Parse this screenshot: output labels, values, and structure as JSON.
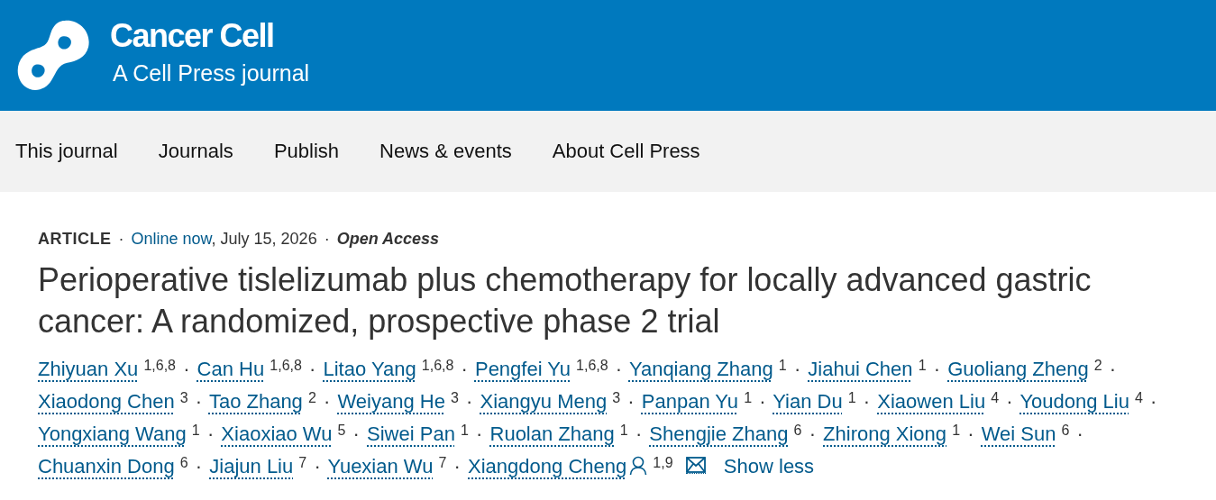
{
  "header": {
    "journal": "Cancer Cell",
    "subtitle": "A Cell Press journal"
  },
  "nav": {
    "items": [
      {
        "label": "This journal"
      },
      {
        "label": "Journals"
      },
      {
        "label": "Publish"
      },
      {
        "label": "News & events"
      },
      {
        "label": "About Cell Press"
      }
    ]
  },
  "article": {
    "type": "ARTICLE",
    "separator": "·",
    "status_link": "Online now",
    "date": ", July 15, 2026",
    "access": "Open Access",
    "title": "Perioperative tislelizumab plus chemotherapy for locally advanced gastric cancer: A randomized, prospective phase 2 trial",
    "authors": [
      {
        "name": "Zhiyuan Xu",
        "affiliations": "1,6,8",
        "corresponding": false
      },
      {
        "name": "Can Hu",
        "affiliations": "1,6,8",
        "corresponding": false
      },
      {
        "name": "Litao Yang",
        "affiliations": "1,6,8",
        "corresponding": false
      },
      {
        "name": "Pengfei Yu",
        "affiliations": "1,6,8",
        "corresponding": false
      },
      {
        "name": "Yanqiang Zhang",
        "affiliations": "1",
        "corresponding": false
      },
      {
        "name": "Jiahui Chen",
        "affiliations": "1",
        "corresponding": false
      },
      {
        "name": "Guoliang Zheng",
        "affiliations": "2",
        "corresponding": false
      },
      {
        "name": "Xiaodong Chen",
        "affiliations": "3",
        "corresponding": false
      },
      {
        "name": "Tao Zhang",
        "affiliations": "2",
        "corresponding": false
      },
      {
        "name": "Weiyang He",
        "affiliations": "3",
        "corresponding": false
      },
      {
        "name": "Xiangyu Meng",
        "affiliations": "3",
        "corresponding": false
      },
      {
        "name": "Panpan Yu",
        "affiliations": "1",
        "corresponding": false
      },
      {
        "name": "Yian Du",
        "affiliations": "1",
        "corresponding": false
      },
      {
        "name": "Xiaowen Liu",
        "affiliations": "4",
        "corresponding": false
      },
      {
        "name": "Youdong Liu",
        "affiliations": "4",
        "corresponding": false
      },
      {
        "name": "Yongxiang Wang",
        "affiliations": "1",
        "corresponding": false
      },
      {
        "name": "Xiaoxiao Wu",
        "affiliations": "5",
        "corresponding": false
      },
      {
        "name": "Siwei Pan",
        "affiliations": "1",
        "corresponding": false
      },
      {
        "name": "Ruolan Zhang",
        "affiliations": "1",
        "corresponding": false
      },
      {
        "name": "Shengjie Zhang",
        "affiliations": "6",
        "corresponding": false
      },
      {
        "name": "Zhirong Xiong",
        "affiliations": "1",
        "corresponding": false
      },
      {
        "name": "Wei Sun",
        "affiliations": "6",
        "corresponding": false
      },
      {
        "name": "Chuanxin Dong",
        "affiliations": "6",
        "corresponding": false
      },
      {
        "name": "Jiajun Liu",
        "affiliations": "7",
        "corresponding": false
      },
      {
        "name": "Yuexian Wu",
        "affiliations": "7",
        "corresponding": false
      },
      {
        "name": "Xiangdong Cheng",
        "affiliations": "1,9",
        "corresponding": true
      }
    ],
    "toggle": "Show less"
  }
}
